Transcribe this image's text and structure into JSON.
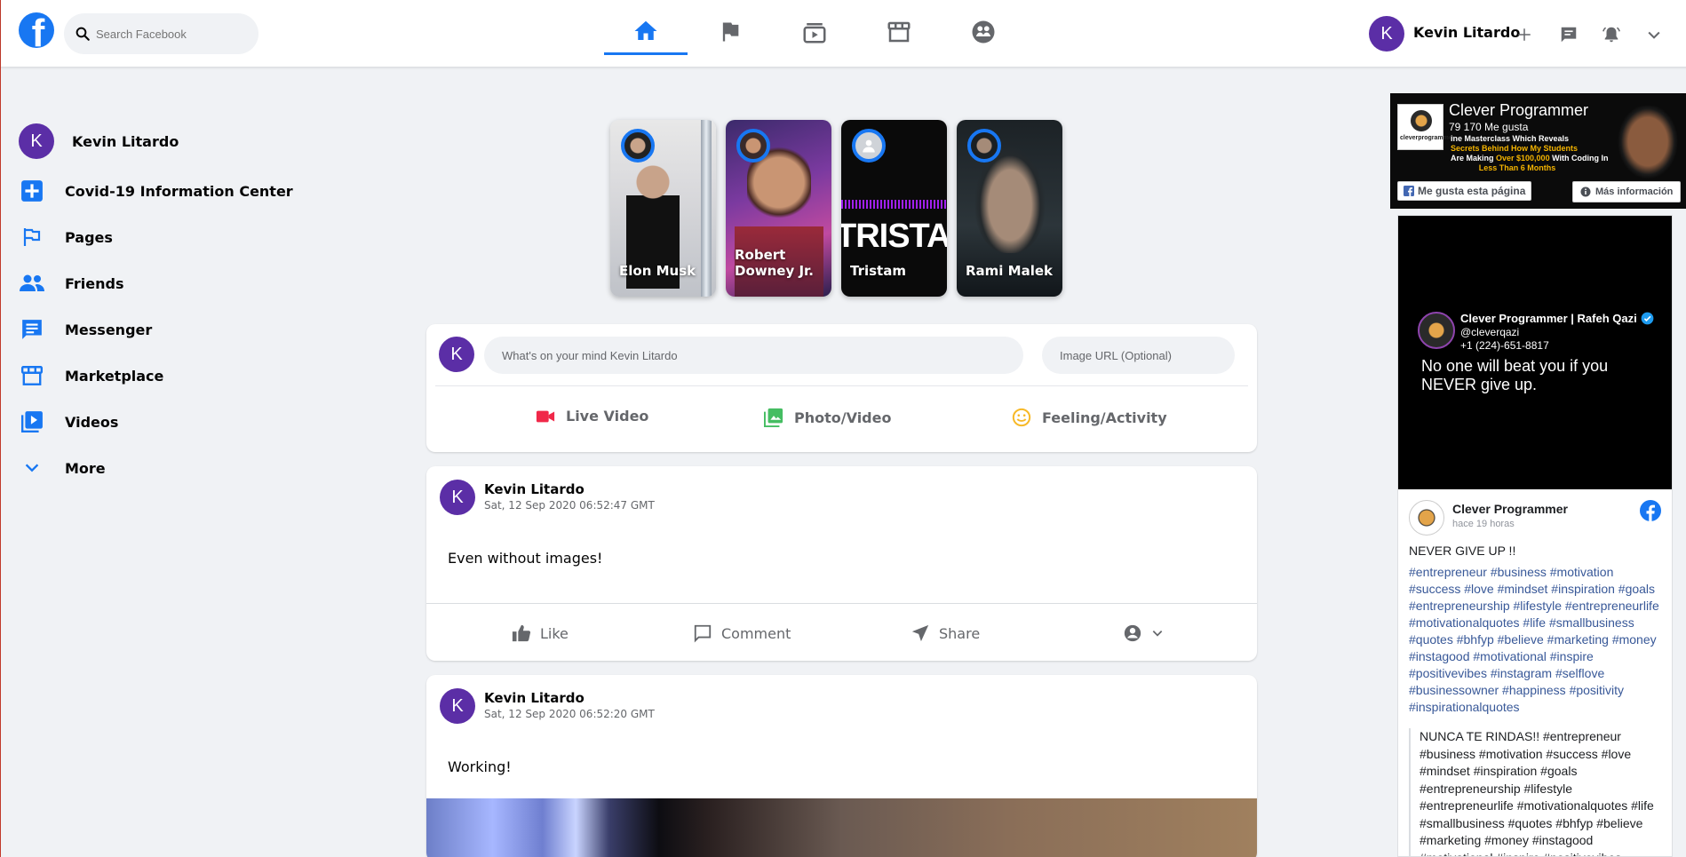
{
  "header": {
    "search_placeholder": "Search Facebook",
    "user_name": "Kevin Litardo",
    "user_initial": "K",
    "nav_tabs": [
      "home",
      "pages",
      "watch",
      "marketplace",
      "groups"
    ]
  },
  "sidebar": {
    "user_name": "Kevin Litardo",
    "user_initial": "K",
    "items": [
      {
        "label": "Covid-19 Information Center",
        "icon": "plus-square-icon"
      },
      {
        "label": "Pages",
        "icon": "flag-icon"
      },
      {
        "label": "Friends",
        "icon": "people-icon"
      },
      {
        "label": "Messenger",
        "icon": "chat-icon"
      },
      {
        "label": "Marketplace",
        "icon": "store-icon"
      },
      {
        "label": "Videos",
        "icon": "video-library-icon"
      },
      {
        "label": "More",
        "icon": "chevron-down-icon"
      }
    ]
  },
  "stories": [
    {
      "name": "Elon Musk"
    },
    {
      "name": "Robert Downey Jr."
    },
    {
      "name": "Tristam"
    },
    {
      "name": "Rami Malek"
    }
  ],
  "composer": {
    "initial": "K",
    "message_placeholder": "What's on your mind Kevin Litardo",
    "image_placeholder": "Image URL (Optional)",
    "options": [
      "Live Video",
      "Photo/Video",
      "Feeling/Activity"
    ]
  },
  "posts": [
    {
      "initial": "K",
      "author": "Kevin Litardo",
      "timestamp": "Sat, 12 Sep 2020 06:52:47 GMT",
      "text": "Even without images!"
    },
    {
      "initial": "K",
      "author": "Kevin Litardo",
      "timestamp": "Sat, 12 Sep 2020 06:52:20 GMT",
      "text": "Working!"
    }
  ],
  "actions": {
    "like": "Like",
    "comment": "Comment",
    "share": "Share"
  },
  "widget": {
    "page_name": "Clever Programmer",
    "likes": "79 170 Me gusta",
    "banner_line1": "ine Masterclass Which Reveals",
    "banner_line2": "Secrets Behind How My Students",
    "banner_line3_pre": "Are Making ",
    "banner_line3_hl": "Over $100,000",
    "banner_line3_post": " With Coding In",
    "banner_line4": "Less Than 6 Months",
    "like_page_button": "Me gusta esta página",
    "more_info_button": "Más información",
    "video_author": "Clever Programmer | Rafeh Qazi",
    "video_handle": "@cleverqazi",
    "video_phone": "+1 (224)-651-8817",
    "video_quote": "No one will beat you if you NEVER give up.",
    "post_author": "Clever Programmer",
    "post_time": "hace 19 horas",
    "post_title": "NEVER GIVE UP !!",
    "post_tags": "#entrepreneur #business #motivation #success #love #mindset #inspiration #goals #entrepreneurship #lifestyle #entrepreneurlife #motivationalquotes #life #smallbusiness #quotes #bhfyp #believe #marketing #money #instagood #motivational #inspire #positivevibes #instagram #selflove #businessowner #happiness #positivity #inspirationalquotes",
    "quote_text": "NUNCA TE RINDAS!! #entrepreneur #business #motivation #success #love #mindset #inspiration #goals #entrepreneurship #lifestyle #entrepreneurlife #motivationalquotes #life #smallbusiness #quotes #bhfyp #believe #marketing #money #instagood #motivational #inspire #positivevibes"
  },
  "colors": {
    "brand": "#1877f2",
    "avatar": "#5b2ea6",
    "live": "#f02849",
    "photo": "#45bd62",
    "feeling": "#f7b928"
  }
}
